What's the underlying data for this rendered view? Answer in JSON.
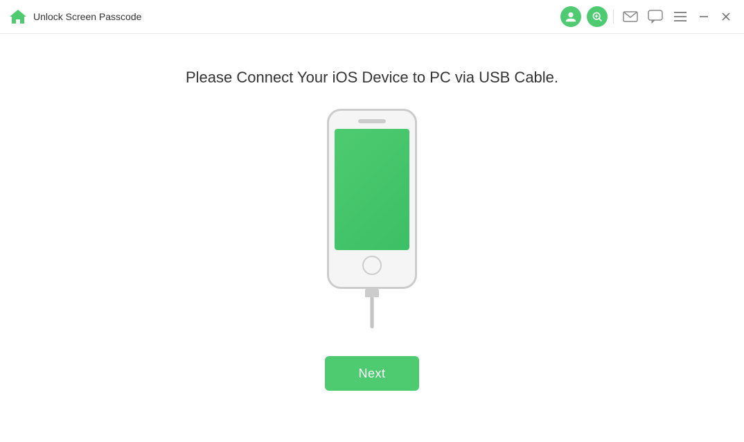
{
  "titleBar": {
    "appTitle": "Unlock Screen Passcode",
    "icons": {
      "account": "👤",
      "update": "🔍",
      "mail": "✉",
      "chat": "💬",
      "menu": "☰",
      "minimize": "—",
      "close": "✕"
    }
  },
  "main": {
    "instructionText": "Please Connect Your iOS Device to PC via USB Cable.",
    "nextButton": "Next"
  }
}
